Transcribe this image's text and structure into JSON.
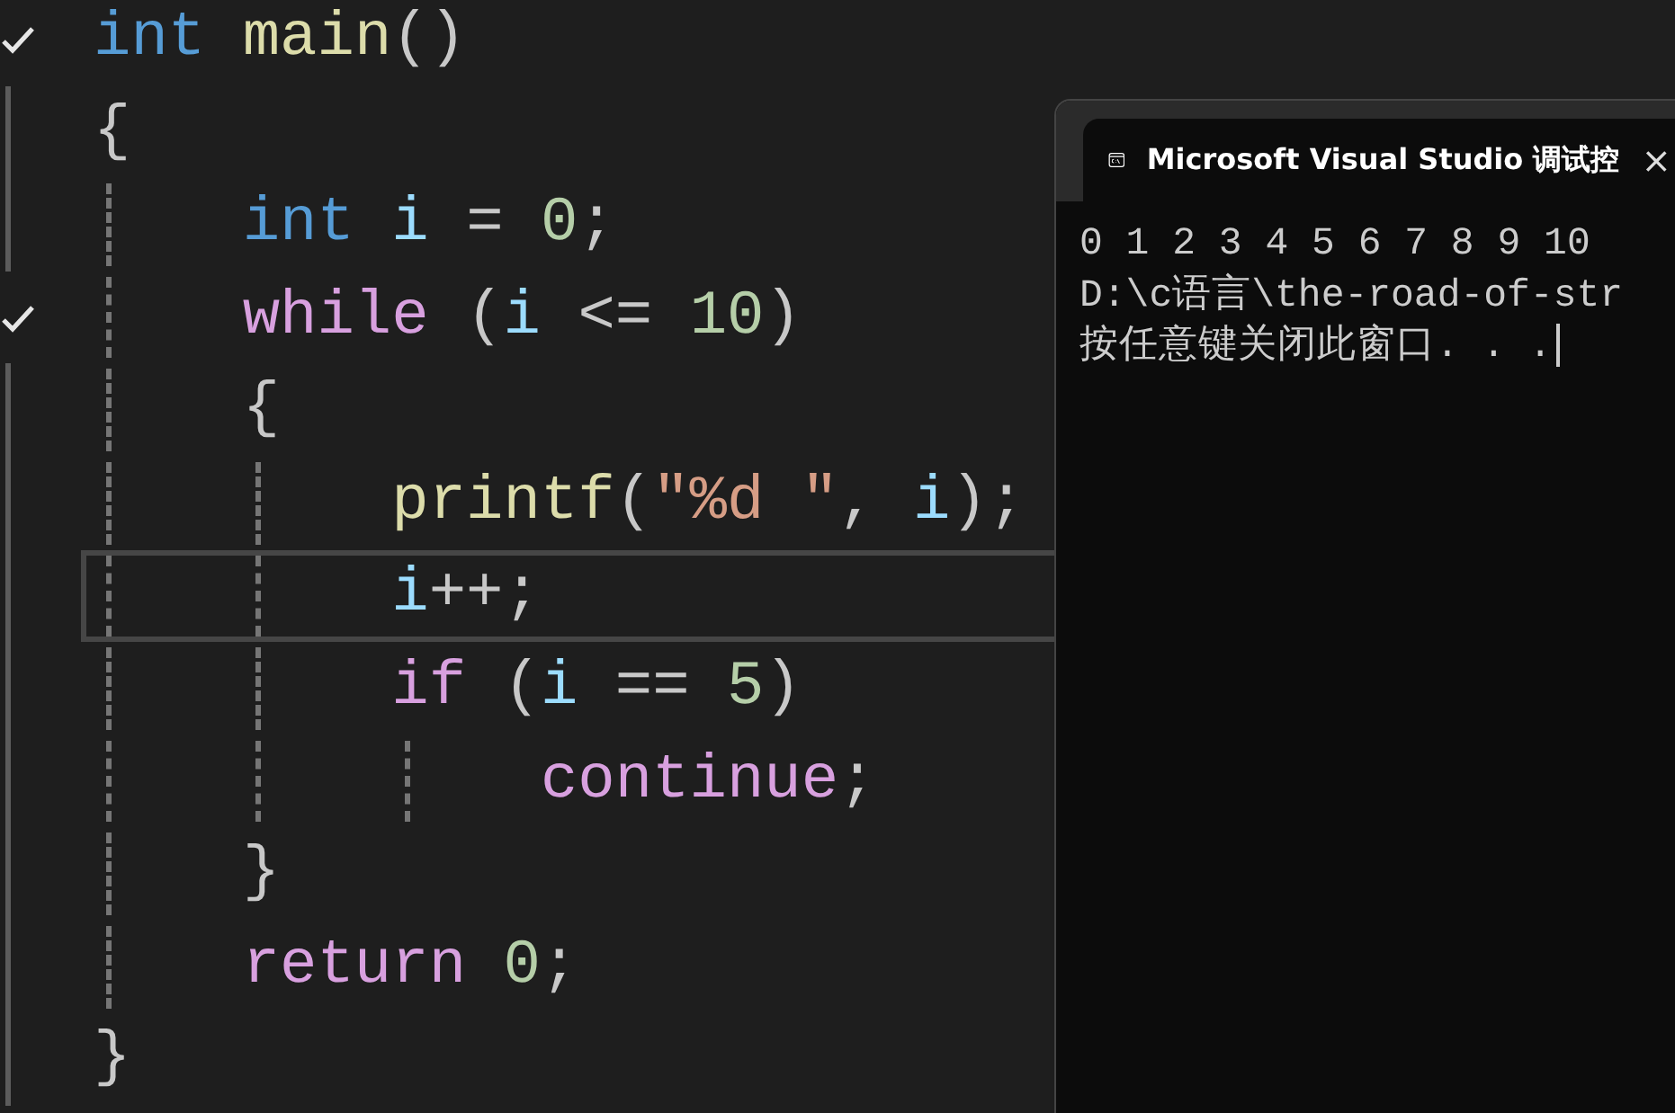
{
  "editor": {
    "lines": [
      {
        "bookmarked": true,
        "selected": false,
        "tokens": [
          {
            "kind": "keyword",
            "text": "int"
          },
          {
            "kind": "function",
            "text": " main"
          },
          {
            "kind": "punct",
            "text": "()"
          }
        ]
      },
      {
        "bookmarked": false,
        "selected": false,
        "tokens": [
          {
            "kind": "punct",
            "text": "{"
          }
        ],
        "children": [
          {
            "bookmarked": false,
            "selected": false,
            "tokens": [
              {
                "kind": "keyword",
                "text": "int"
              },
              {
                "kind": "variable",
                "text": " i"
              },
              {
                "kind": "punct",
                "text": " = "
              },
              {
                "kind": "number",
                "text": "0"
              },
              {
                "kind": "punct",
                "text": ";"
              }
            ]
          },
          {
            "bookmarked": true,
            "selected": false,
            "tokens": [
              {
                "kind": "control",
                "text": "while"
              },
              {
                "kind": "punct",
                "text": " ("
              },
              {
                "kind": "variable",
                "text": "i"
              },
              {
                "kind": "punct",
                "text": " <= "
              },
              {
                "kind": "number",
                "text": "10"
              },
              {
                "kind": "punct",
                "text": ")"
              }
            ]
          },
          {
            "bookmarked": false,
            "selected": false,
            "tokens": [
              {
                "kind": "punct",
                "text": "{"
              }
            ],
            "children": [
              {
                "bookmarked": false,
                "selected": false,
                "tokens": [
                  {
                    "kind": "function",
                    "text": "printf"
                  },
                  {
                    "kind": "punct",
                    "text": "("
                  },
                  {
                    "kind": "string",
                    "text": "\"%d \""
                  },
                  {
                    "kind": "punct",
                    "text": ", "
                  },
                  {
                    "kind": "variable",
                    "text": "i"
                  },
                  {
                    "kind": "punct",
                    "text": ");"
                  }
                ]
              },
              {
                "bookmarked": false,
                "selected": true,
                "tokens": [
                  {
                    "kind": "variable",
                    "text": "i"
                  },
                  {
                    "kind": "punct",
                    "text": "++;"
                  }
                ]
              },
              {
                "bookmarked": false,
                "selected": false,
                "tokens": [
                  {
                    "kind": "control",
                    "text": "if"
                  },
                  {
                    "kind": "punct",
                    "text": " ("
                  },
                  {
                    "kind": "variable",
                    "text": "i"
                  },
                  {
                    "kind": "punct",
                    "text": " == "
                  },
                  {
                    "kind": "number",
                    "text": "5"
                  },
                  {
                    "kind": "punct",
                    "text": ")"
                  }
                ],
                "children": [
                  {
                    "bookmarked": false,
                    "selected": false,
                    "tokens": [
                      {
                        "kind": "control",
                        "text": "continue"
                      },
                      {
                        "kind": "punct",
                        "text": ";"
                      }
                    ]
                  }
                ]
              }
            ]
          },
          {
            "bookmarked": false,
            "selected": false,
            "tokens": [
              {
                "kind": "punct",
                "text": "}"
              }
            ]
          },
          {
            "bookmarked": false,
            "selected": false,
            "tokens": [
              {
                "kind": "control",
                "text": "return"
              },
              {
                "kind": "number",
                "text": " 0"
              },
              {
                "kind": "punct",
                "text": ";"
              }
            ]
          }
        ]
      },
      {
        "bookmarked": false,
        "selected": false,
        "tokens": [
          {
            "kind": "punct",
            "text": "}"
          }
        ]
      }
    ]
  },
  "console": {
    "title": "Microsoft Visual Studio 调试控",
    "close": "×",
    "lines": [
      "0 1 2 3 4 5 6 7 8 9 10",
      "D:\\c语言\\the-road-of-str",
      "按任意键关闭此窗口. . ."
    ]
  }
}
